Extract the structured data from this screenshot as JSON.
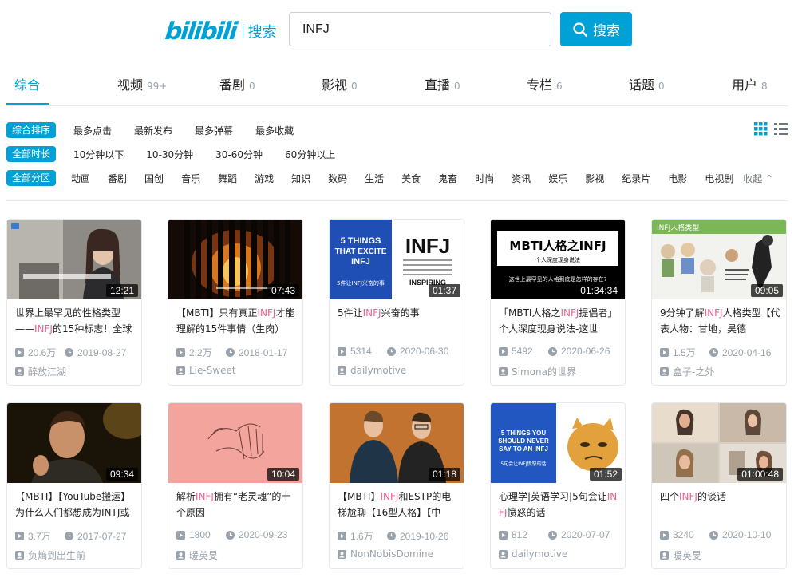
{
  "header": {
    "logo_text": "bilibili",
    "logo_sub": "搜索",
    "search_value": "INFJ",
    "search_button": "搜索"
  },
  "tabs": [
    {
      "label": "综合",
      "count": ""
    },
    {
      "label": "视频",
      "count": "99+"
    },
    {
      "label": "番剧",
      "count": "0"
    },
    {
      "label": "影视",
      "count": "0"
    },
    {
      "label": "直播",
      "count": "0"
    },
    {
      "label": "专栏",
      "count": "6"
    },
    {
      "label": "话题",
      "count": "0"
    },
    {
      "label": "用户",
      "count": "8"
    }
  ],
  "filters": {
    "sort": {
      "label": "综合排序",
      "options": [
        "最多点击",
        "最新发布",
        "最多弹幕",
        "最多收藏"
      ]
    },
    "duration": {
      "label": "全部时长",
      "options": [
        "10分钟以下",
        "10-30分钟",
        "30-60分钟",
        "60分钟以上"
      ]
    },
    "zone": {
      "label": "全部分区",
      "options": [
        "动画",
        "番剧",
        "国创",
        "音乐",
        "舞蹈",
        "游戏",
        "知识",
        "数码",
        "生活",
        "美食",
        "鬼畜",
        "时尚",
        "资讯",
        "娱乐",
        "影视",
        "纪录片",
        "电影",
        "电视剧"
      ],
      "collapse": "收起"
    }
  },
  "colors": {
    "accent": "#00a1d6",
    "highlight": "#f25d8e",
    "meta": "#99a2aa"
  },
  "videos": [
    {
      "duration": "12:21",
      "title_parts": [
        "世界上最罕见的性格类型——",
        "INFJ",
        "的15种标志！全球"
      ],
      "plays": "20.6万",
      "date": "2019-08-27",
      "uploader": "醉放江湖"
    },
    {
      "duration": "07:43",
      "title_parts": [
        "【MBTI】只有真正",
        "INFJ",
        "才能理解的15件事情（生肉）"
      ],
      "plays": "2.2万",
      "date": "2018-01-17",
      "uploader": "Lie-Sweet"
    },
    {
      "duration": "01:37",
      "title_parts": [
        "5件让",
        "INFJ",
        "兴奋的事"
      ],
      "plays": "5314",
      "date": "2020-06-30",
      "uploader": "dailymotive"
    },
    {
      "duration": "01:34:34",
      "title_parts": [
        "「MBTI人格之",
        "INFJ",
        "提倡者」个人深度现身说法-这世"
      ],
      "plays": "5492",
      "date": "2020-06-26",
      "uploader": "Simona的世界"
    },
    {
      "duration": "09:05",
      "title_parts": [
        "9分钟了解",
        "INFJ",
        "人格类型【代表人物：甘地，昊德"
      ],
      "plays": "1.5万",
      "date": "2020-04-16",
      "uploader": "盒子-之外"
    },
    {
      "duration": "09:34",
      "title_parts": [
        "【MBTI】【YouTube搬运】为什么人们都想成为INTJ或",
        "",
        ""
      ],
      "plays": "3.7万",
      "date": "2017-07-27",
      "uploader": "负熵到出生前"
    },
    {
      "duration": "10:04",
      "title_parts": [
        "解析",
        "INFJ",
        "拥有“老灵魂”的十个原因"
      ],
      "plays": "1800",
      "date": "2020-09-23",
      "uploader": "暖英旻"
    },
    {
      "duration": "01:18",
      "title_parts": [
        "【MBTI】",
        "INFJ",
        "和ESTP的电梯尬聊【16型人格】【中"
      ],
      "plays": "1.6万",
      "date": "2019-10-26",
      "uploader": "NonNobisDomine"
    },
    {
      "duration": "01:52",
      "title_parts": [
        "心理学|英语学习|5句会让",
        "INFJ",
        "愤怒的话"
      ],
      "plays": "812",
      "date": "2020-07-07",
      "uploader": "dailymotive"
    },
    {
      "duration": "01:00:48",
      "title_parts": [
        "四个",
        "INFJ",
        "的谈话"
      ],
      "plays": "3240",
      "date": "2020-10-10",
      "uploader": "暖英旻"
    }
  ],
  "thumb_text": {
    "t3_left": "5 THINGS THAT EXCITE INFJ",
    "t3_right": "INFJ",
    "t3_sub": "5件让INFJ兴奋的事",
    "t4_title": "MBTI人格之INFJ",
    "t4_sub": "个人深度现身说法",
    "t4_line": "这世上最罕见的人格到底是怎样的存在?",
    "t5_banner": "INFJ人格类型",
    "t9_text": "5 THINGS YOU SHOULD NEVER SAY TO AN INFJ",
    "t9_sub": "5句会让INFJ愤怒的话"
  }
}
